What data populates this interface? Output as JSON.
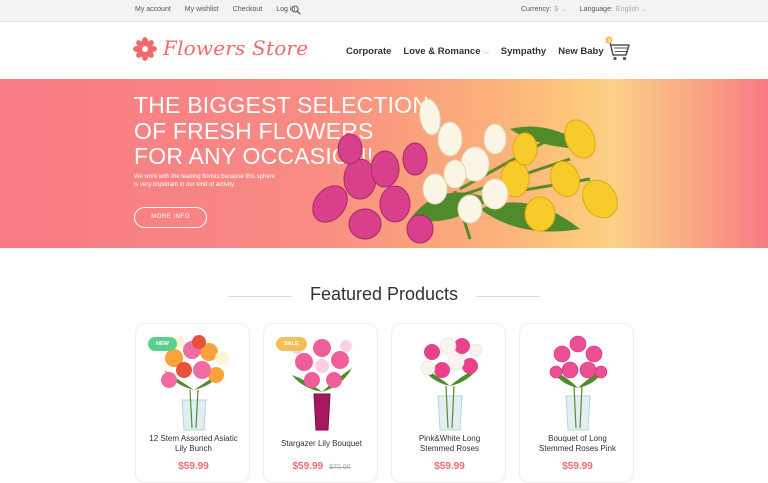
{
  "topbar": {
    "links": [
      "My account",
      "My wishlist",
      "Checkout",
      "Log in"
    ],
    "currency_label": "Currency:",
    "currency_value": "$",
    "language_label": "Language:",
    "language_value": "English"
  },
  "header": {
    "logo_text": "Flowers Store",
    "nav": [
      "Corporate",
      "Love & Romance",
      "Sympathy",
      "New Baby"
    ],
    "cart_count": "0"
  },
  "hero": {
    "heading_lines": [
      "THE BIGGEST SELECTION",
      "OF FRESH FLOWERS",
      "FOR ANY OCCASION!"
    ],
    "subtext_lines": [
      "We work with the leading florists because this sphere",
      "is very important in our kind of activity."
    ],
    "button_label": "MORE INFO"
  },
  "featured": {
    "title": "Featured Products",
    "products": [
      {
        "name_lines": [
          "12 Stem Assorted Asiatic",
          "Lily Bunch"
        ],
        "price": "$59.99",
        "old_price": "",
        "badge": "NEW",
        "badge_color": "#5ccf8e"
      },
      {
        "name_lines": [
          "Stargazer Lily Bouquet"
        ],
        "price": "$59.99",
        "old_price": "$70.00",
        "badge": "SALE",
        "badge_color": "#f5c05a"
      },
      {
        "name_lines": [
          "Pink&White Long",
          "Stemmed Roses"
        ],
        "price": "$59.99",
        "old_price": "",
        "badge": "",
        "badge_color": ""
      },
      {
        "name_lines": [
          "Bouquet of Long",
          "Stemmed Roses Pink"
        ],
        "price": "$59.99",
        "old_price": "",
        "badge": "",
        "badge_color": ""
      }
    ]
  },
  "colors": {
    "accent": "#f06b6b",
    "hero_start": "#f77a85",
    "hero_mid": "#fcc87a",
    "new_badge": "#5ccf8e",
    "sale_badge": "#f5c05a"
  },
  "icons": {
    "search": "search-icon",
    "cart": "shopping-cart-icon",
    "logo": "flower-logo-icon"
  }
}
